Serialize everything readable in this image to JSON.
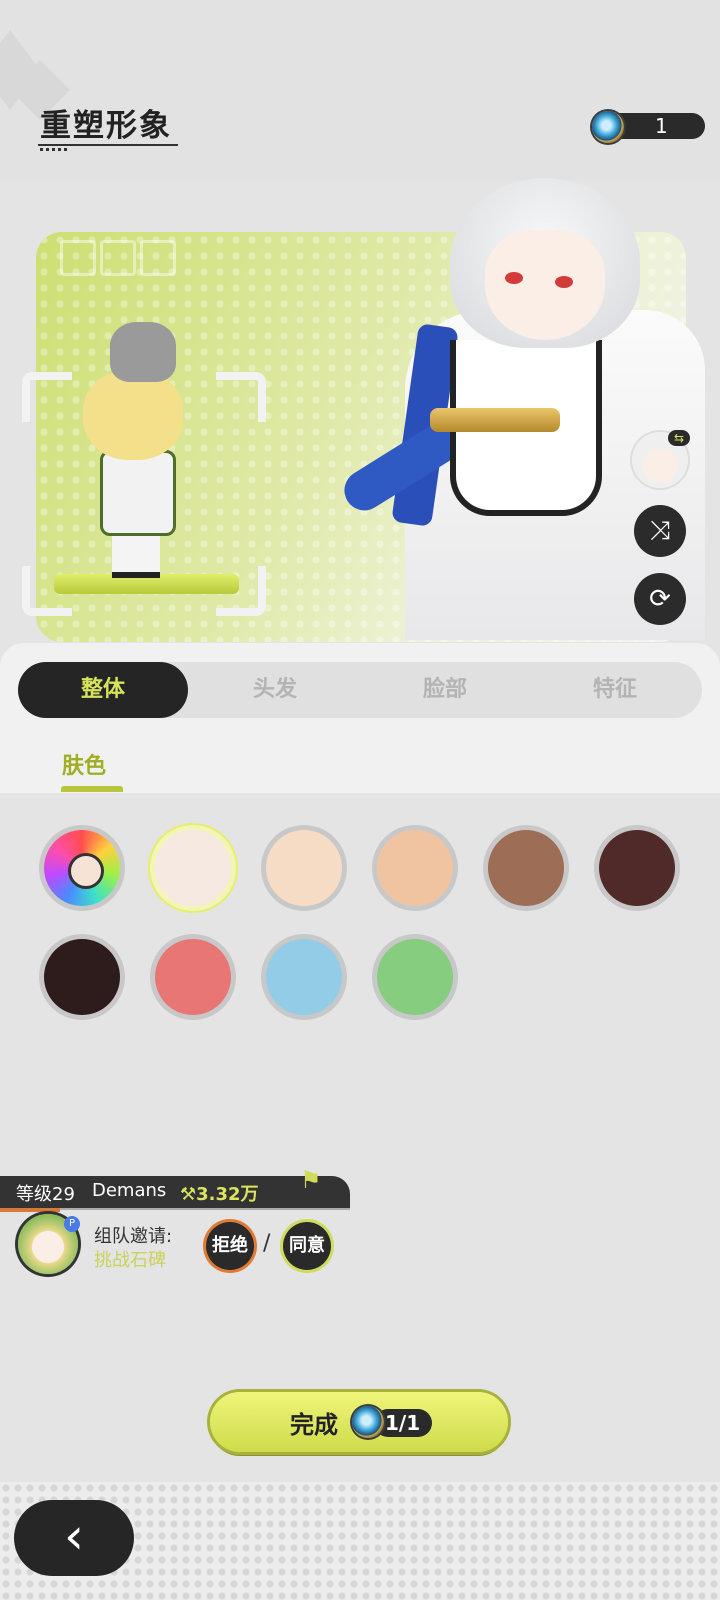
{
  "header": {
    "title": "重塑形象",
    "currency_value": "1",
    "currency_icon": "mirror-icon"
  },
  "preview": {
    "side_buttons": [
      {
        "name": "shuffle",
        "icon": "shuffle-icon",
        "glyph": "⤨"
      },
      {
        "name": "refresh",
        "icon": "refresh-icon",
        "glyph": "⟳"
      }
    ]
  },
  "tabs": [
    {
      "label": "整体",
      "active": true
    },
    {
      "label": "头发",
      "active": false
    },
    {
      "label": "脸部",
      "active": false
    },
    {
      "label": "特征",
      "active": false
    }
  ],
  "subtab": {
    "label": "肤色",
    "active": true
  },
  "colors": {
    "accent": "#d7e45a",
    "swatches": [
      {
        "type": "custom-wheel"
      },
      {
        "hex": "#f6e9e1",
        "selected": true
      },
      {
        "hex": "#f6dcc5"
      },
      {
        "hex": "#f1c4a1"
      },
      {
        "hex": "#9e6d55"
      },
      {
        "hex": "#4f2a29"
      },
      {
        "hex": "#2e1b1b"
      },
      {
        "hex": "#e77675"
      },
      {
        "hex": "#92cce6"
      },
      {
        "hex": "#86cd7f"
      }
    ]
  },
  "invite": {
    "level": "等级29",
    "name": "Demans",
    "power": "⚒3.32万",
    "label": "组队邀请:",
    "activity": "挑战石碑",
    "reject": "拒绝",
    "accept": "同意",
    "separator": "/",
    "badge": "P"
  },
  "done": {
    "label": "完成",
    "cost": "1/1"
  },
  "footer": {
    "back_glyph": "‹"
  }
}
